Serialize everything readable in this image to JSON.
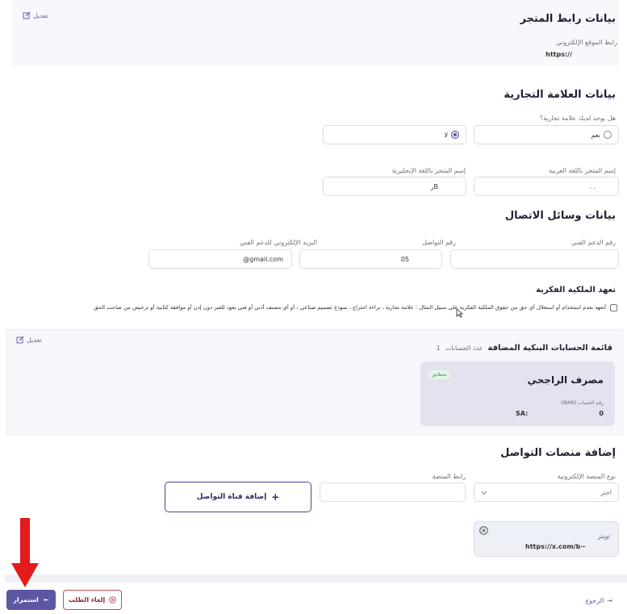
{
  "store_link": {
    "title": "بيانات رابط المتجر",
    "edit_label": "تعديل",
    "url_label": "رابط الموقع الإلكتروني",
    "url_value": "https://"
  },
  "brand": {
    "title": "بيانات العلامة التجارية",
    "question": "هل يوجد لديك علامة تجارية؟",
    "option_yes": "نعم",
    "option_no": "لا",
    "selected": "لا",
    "name_ar_label": "إسم المتجر باللغة العربية",
    "name_ar_value": ". .",
    "name_en_label": "إسم المتجر باللغة الإنجليزية",
    "name_en_value": "رB"
  },
  "contact": {
    "title": "بيانات وسائل الاتصال",
    "support_phone_label": "رقم الدعم الفني",
    "support_phone_value": "",
    "contact_phone_label": "رقم التواصل",
    "contact_phone_value": "05",
    "support_email_label": "البريد الإلكتروني للدعم الفني",
    "support_email_value": "@gmail.com"
  },
  "ip": {
    "title": "تعهد الملكية الفكرية",
    "pledge_text": "أتعهد بعدم استخدام أو استغلال أي حق من حقوق الملكية الفكرية على سبيل المثال : علامة تجارية ، براءة اختراع ، نموذج تصميم صناعي ، أو أي مصنف أدبي أو فني يعود للغير دون إذن أو موافقة كتابية أو ترخيص من صاحب الحق"
  },
  "bank": {
    "title": "قائمة الحسابات البنكية المضافة",
    "count_label": "عدد الحسابات",
    "count_value": "1",
    "edit_label": "تعديل",
    "bank_name": "مصرف الراجحي",
    "status_badge": "متطابق",
    "iban_label": "رقم الحساب (IBAN)",
    "iban_prefix": "SA:",
    "iban_end": "0"
  },
  "social": {
    "title": "إضافة منصات التواصل",
    "platform_type_label": "نوع المنصة الإلكترونية",
    "platform_type_placeholder": "اختر",
    "platform_link_label": "رابط المنصة",
    "platform_link_value": "",
    "add_button": "إضافة قناة التواصل",
    "card_platform": "تويتر",
    "card_url": "https://x.com/b~"
  },
  "footer": {
    "back": "الرجوع",
    "cancel": "إلغاء الطلب",
    "continue": "استمرار"
  },
  "colors": {
    "primary": "#5b57a3",
    "danger": "#c94c5a",
    "success": "#2f9a4c",
    "arrow": "#e31b1b"
  }
}
